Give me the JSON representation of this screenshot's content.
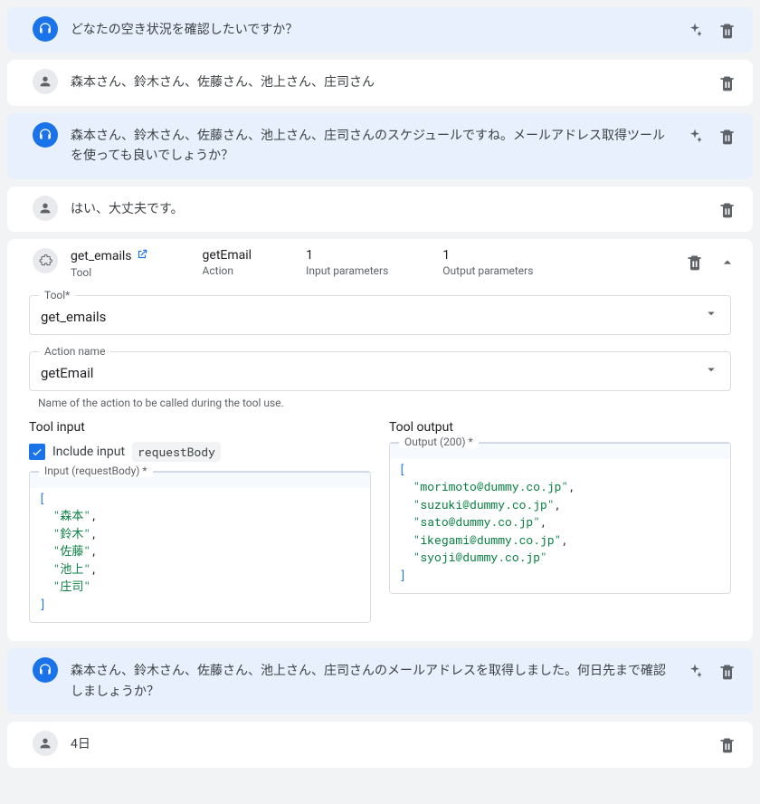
{
  "messages": [
    {
      "role": "bot",
      "text": "どなたの空き状況を確認したいですか？",
      "sparkle": true
    },
    {
      "role": "user",
      "text": "森本さん、鈴木さん、佐藤さん、池上さん、庄司さん",
      "sparkle": false
    },
    {
      "role": "bot",
      "text": "森本さん、鈴木さん、佐藤さん、池上さん、庄司さんのスケジュールですね。メールアドレス取得ツールを使っても良いでしょうか？",
      "sparkle": true
    },
    {
      "role": "user",
      "text": "はい、大丈夫です。",
      "sparkle": false
    }
  ],
  "tool": {
    "name": "get_emails",
    "name_sub": "Tool",
    "action": "getEmail",
    "action_sub": "Action",
    "input_count": "1",
    "input_sub": "Input parameters",
    "output_count": "1",
    "output_sub": "Output parameters",
    "field_tool_label": "Tool*",
    "field_tool_value": "get_emails",
    "field_action_label": "Action name",
    "field_action_value": "getEmail",
    "field_action_helper": "Name of the action to be called during the tool use.",
    "input_title": "Tool input",
    "include_label": "Include input",
    "include_badge": "requestBody",
    "input_field_label": "Input (requestBody) *",
    "input_json_values": [
      "森本",
      "鈴木",
      "佐藤",
      "池上",
      "庄司"
    ],
    "output_title": "Tool output",
    "output_field_label": "Output (200) *",
    "output_json_values": [
      "morimoto@dummy.co.jp",
      "suzuki@dummy.co.jp",
      "sato@dummy.co.jp",
      "ikegami@dummy.co.jp",
      "syoji@dummy.co.jp"
    ]
  },
  "trailing": [
    {
      "role": "bot",
      "text": "森本さん、鈴木さん、佐藤さん、池上さん、庄司さんのメールアドレスを取得しました。何日先まで確認しましょうか？",
      "sparkle": true
    },
    {
      "role": "user",
      "text": "4日",
      "sparkle": false
    }
  ]
}
